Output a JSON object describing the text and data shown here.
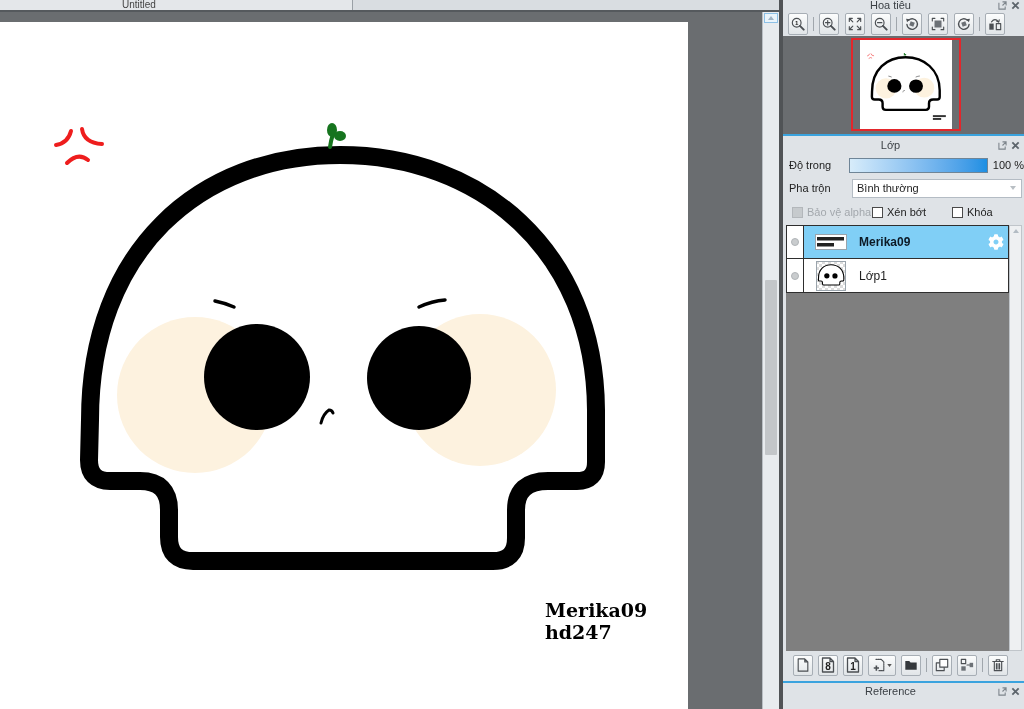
{
  "document_tab": {
    "title": "Untitled"
  },
  "canvas": {
    "signature": [
      "Merika09",
      "hd247"
    ]
  },
  "navigator": {
    "title": "Hoa tiêu",
    "actual_size_label": "1"
  },
  "layers_panel": {
    "title": "Lớp",
    "opacity": {
      "label": "Độ trong",
      "level": 1,
      "reading": "100 %"
    },
    "blend": {
      "label": "Pha trộn",
      "value": "Bình thường"
    },
    "options": [
      {
        "label": "Bảo vệ alpha",
        "checked": false,
        "disabled": true
      },
      {
        "label": "Xén bớt",
        "checked": false,
        "disabled": false
      },
      {
        "label": "Khóa",
        "checked": false,
        "disabled": false
      }
    ],
    "layers": [
      {
        "name": "Merika09",
        "kind": "lettering",
        "selected": true
      },
      {
        "name": "Lớp1",
        "kind": "figure",
        "selected": false
      }
    ],
    "new_layer_labels": [
      "8",
      "1"
    ]
  },
  "reference_panel": {
    "title": "Reference"
  }
}
